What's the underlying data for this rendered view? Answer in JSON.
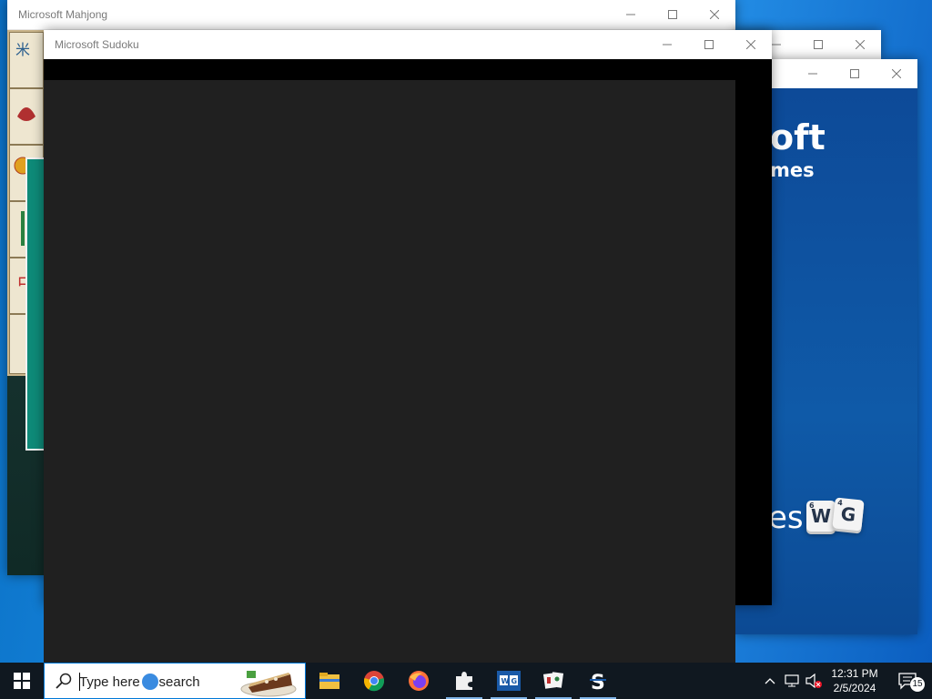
{
  "windows": {
    "mahjong": {
      "title": "Microsoft Mahjong"
    },
    "back": {
      "title": ""
    },
    "words": {
      "title": "",
      "brand_line1": "oft",
      "brand_line2": "mes",
      "brand_line3": "es",
      "tiles": [
        {
          "letter": "W",
          "points": "6"
        },
        {
          "letter": "G",
          "points": "4"
        }
      ]
    },
    "sudoku": {
      "title": "Microsoft Sudoku"
    }
  },
  "taskbar": {
    "search_placeholder": "Type here to search",
    "apps": [
      {
        "name": "file-explorer",
        "label": "File Explorer"
      },
      {
        "name": "chrome",
        "label": "Google Chrome"
      },
      {
        "name": "firefox",
        "label": "Firefox"
      },
      {
        "name": "jigsaw",
        "label": "Microsoft Jigsaw"
      },
      {
        "name": "word-game",
        "label": "Microsoft Word Game"
      },
      {
        "name": "mahjong",
        "label": "Microsoft Mahjong"
      },
      {
        "name": "sudoku",
        "label": "Microsoft Sudoku"
      }
    ],
    "clock_time": "12:31 PM",
    "clock_date": "2/5/2024",
    "notification_count": "15"
  },
  "colors": {
    "taskbar": "#101820",
    "accent": "#0078d7",
    "sudoku_panel": "#202020"
  }
}
